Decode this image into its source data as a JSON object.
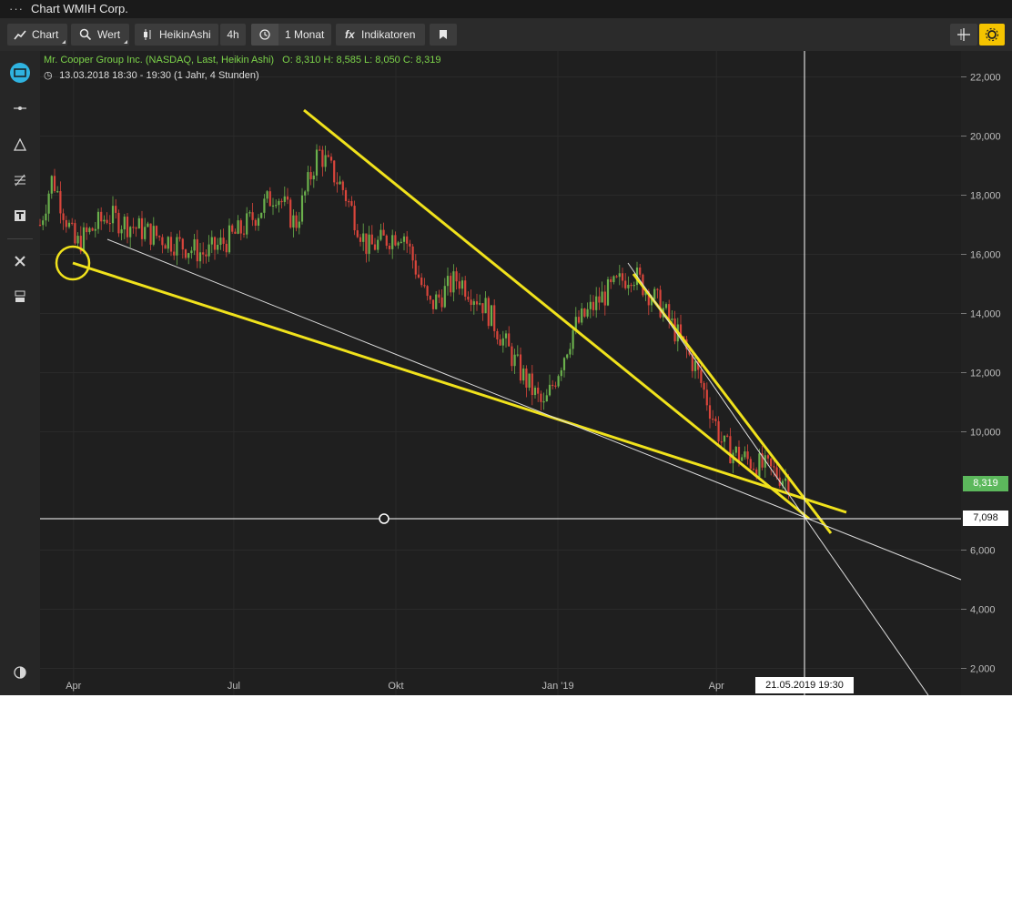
{
  "window": {
    "title": "Chart WMIH Corp.",
    "menu_icon": "ellipsis-icon"
  },
  "toolbar": {
    "chart_label": "Chart",
    "wert_label": "Wert",
    "heikin_label": "HeikinAshi",
    "interval_label": "4h",
    "period_label": "1 Monat",
    "indicators_label": "Indikatoren",
    "accent_color": "#f5c400"
  },
  "chart_header": {
    "instrument": "Mr. Cooper Group Inc. (NASDAQ, Last, Heikin Ashi)",
    "ohlc": "O: 8,310  H: 8,585  L: 8,050  C: 8,319",
    "range": "13.03.2018 18:30 - 19:30  (1 Jahr, 4 Stunden)"
  },
  "chart_data": {
    "type": "line",
    "chart_style": "heikin-ashi candlestick",
    "y_ticks": [
      "22,000",
      "20,000",
      "18,000",
      "16,000",
      "14,000",
      "12,000",
      "10,000",
      "6,000",
      "4,000",
      "2,000"
    ],
    "x_ticks": [
      "Apr",
      "Jul",
      "Okt",
      "Jan '19",
      "Apr"
    ],
    "price_series": [
      {
        "x": "2018-03-13",
        "y": 17.0
      },
      {
        "x": "2018-03-20",
        "y": 18.6
      },
      {
        "x": "2018-04-02",
        "y": 16.3
      },
      {
        "x": "2018-04-20",
        "y": 17.3
      },
      {
        "x": "2018-05-15",
        "y": 16.7
      },
      {
        "x": "2018-06-15",
        "y": 16.0
      },
      {
        "x": "2018-07-05",
        "y": 16.8
      },
      {
        "x": "2018-07-25",
        "y": 18.1
      },
      {
        "x": "2018-08-05",
        "y": 17.0
      },
      {
        "x": "2018-08-18",
        "y": 19.5
      },
      {
        "x": "2018-09-01",
        "y": 18.2
      },
      {
        "x": "2018-09-15",
        "y": 16.2
      },
      {
        "x": "2018-10-05",
        "y": 16.8
      },
      {
        "x": "2018-10-20",
        "y": 14.2
      },
      {
        "x": "2018-11-05",
        "y": 15.2
      },
      {
        "x": "2018-11-20",
        "y": 14.3
      },
      {
        "x": "2018-12-10",
        "y": 12.1
      },
      {
        "x": "2018-12-24",
        "y": 10.8
      },
      {
        "x": "2019-01-10",
        "y": 13.5
      },
      {
        "x": "2019-01-25",
        "y": 14.5
      },
      {
        "x": "2019-02-12",
        "y": 15.4
      },
      {
        "x": "2019-03-01",
        "y": 14.2
      },
      {
        "x": "2019-03-20",
        "y": 12.2
      },
      {
        "x": "2019-04-05",
        "y": 9.5
      },
      {
        "x": "2019-04-20",
        "y": 9.0
      },
      {
        "x": "2019-05-05",
        "y": 8.6
      },
      {
        "x": "2019-05-13",
        "y": 8.319
      }
    ],
    "last_price_label": "8,319",
    "crosshair_value_label": "7,098",
    "crosshair_date_label": "21.05.2019 19:30",
    "colors": {
      "up": "#6ab04c",
      "down": "#d9453b",
      "trendline": "#f0e21c",
      "background": "#1f1f1f",
      "price_badge": "#5cb85c"
    }
  }
}
